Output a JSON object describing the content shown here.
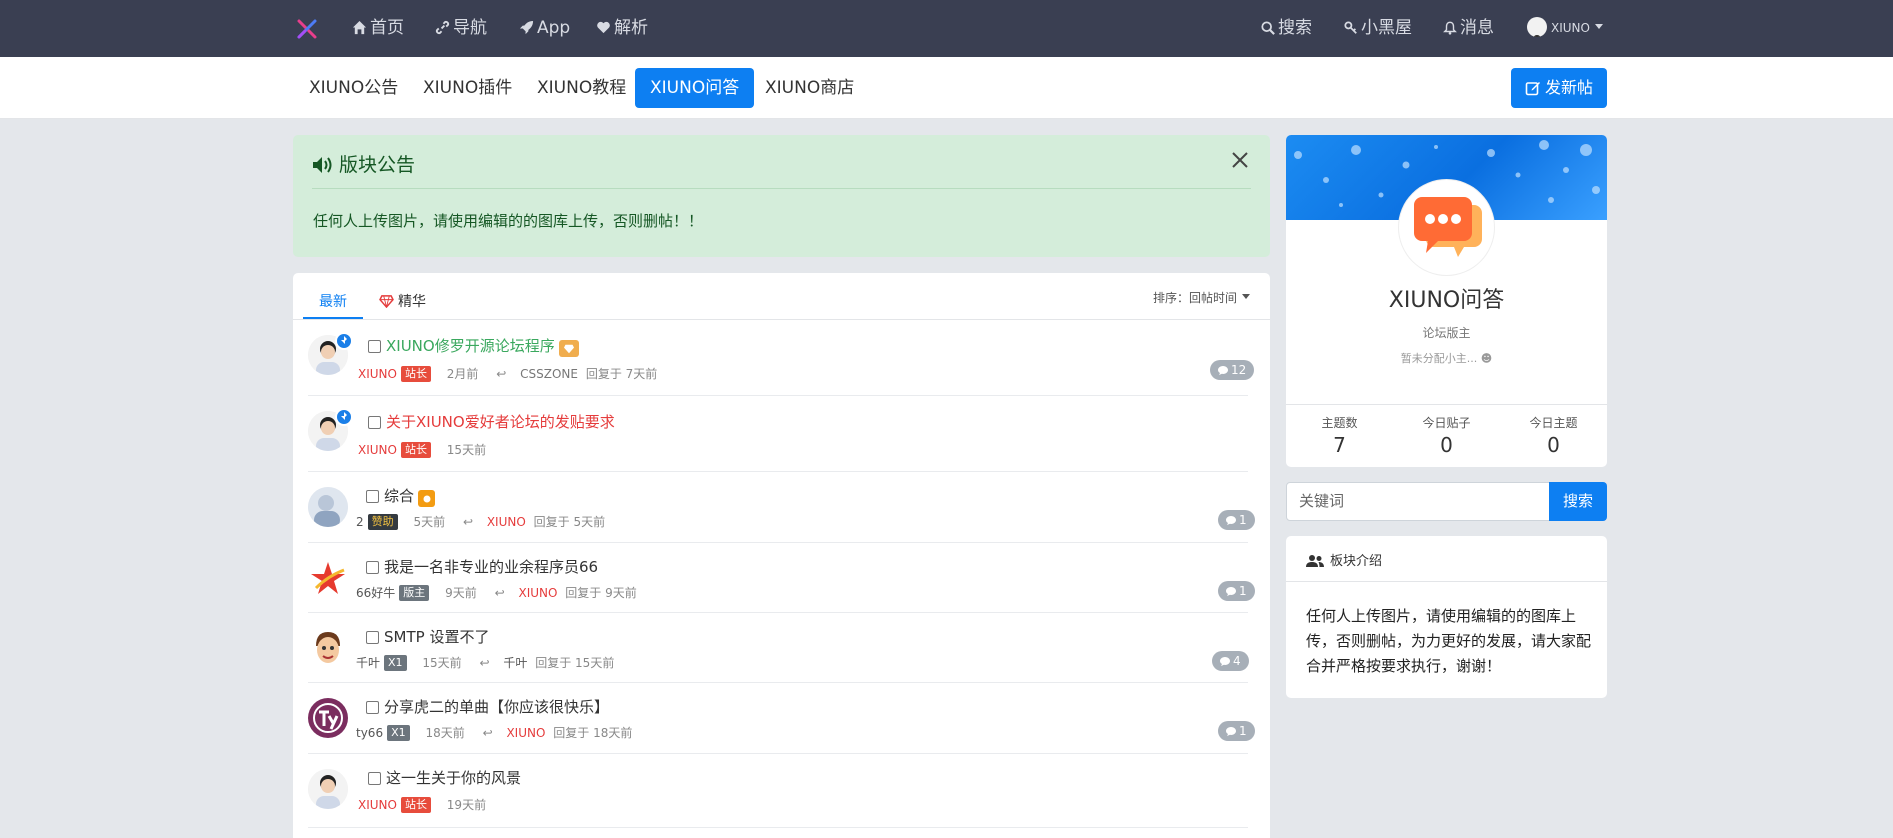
{
  "topnav": {
    "items": [
      {
        "icon": "home-icon",
        "label": "首页"
      },
      {
        "icon": "link-icon",
        "label": "导航"
      },
      {
        "icon": "rocket-icon",
        "label": "App"
      },
      {
        "icon": "heart-icon",
        "label": "解析"
      }
    ],
    "right": [
      {
        "icon": "search-icon",
        "label": "搜索"
      },
      {
        "icon": "key-icon",
        "label": "小黑屋"
      },
      {
        "icon": "bell-icon",
        "label": "消息"
      }
    ],
    "user": "XIUNO"
  },
  "subnav": {
    "tabs": [
      "XIUNO公告",
      "XIUNO插件",
      "XIUNO教程",
      "XIUNO问答",
      "XIUNO商店"
    ],
    "active": "XIUNO问答",
    "new_post": "发新帖"
  },
  "notice": {
    "title": "版块公告",
    "body": "任何人上传图片，请使用编辑的的图库上传，否则删帖！！"
  },
  "thread_tabs": {
    "latest": "最新",
    "featured": "精华",
    "sort_label": "排序：",
    "sort_value": "回帖时间"
  },
  "threads": [
    {
      "title": "XIUNO修罗开源论坛程序",
      "author": "XIUNO",
      "badge": "站长",
      "time": "2月前",
      "last_replier": "CSSZONE",
      "last_time": "回复于 7天前",
      "replies": "12"
    },
    {
      "title": "关于XIUNO爱好者论坛的发贴要求",
      "author": "XIUNO",
      "badge": "站长",
      "time": "15天前"
    },
    {
      "title": "综合",
      "author": "2",
      "badge": "赞助",
      "time": "5天前",
      "last_replier": "XIUNO",
      "last_time": "回复于 5天前",
      "replies": "1"
    },
    {
      "title": "我是一名非专业的业余程序员66",
      "author": "66好牛",
      "badge": "版主",
      "time": "9天前",
      "last_replier": "XIUNO",
      "last_time": "回复于 9天前",
      "replies": "1"
    },
    {
      "title": "SMTP 设置不了",
      "author": "千叶",
      "badge": "X1",
      "time": "15天前",
      "last_replier": "千叶",
      "last_time": "回复于 15天前",
      "replies": "4"
    },
    {
      "title": "分享虎二的单曲【你应该很快乐】",
      "author": "ty66",
      "badge": "X1",
      "time": "18天前",
      "last_replier": "XIUNO",
      "last_time": "回复于 18天前",
      "replies": "1"
    },
    {
      "title": "这一生关于你的风景",
      "author": "XIUNO",
      "badge": "站长",
      "time": "19天前"
    }
  ],
  "profile": {
    "name": "XIUNO问答",
    "role": "论坛版主",
    "moderators": "暂未分配小主...",
    "stats": [
      {
        "label": "主题数",
        "value": "7"
      },
      {
        "label": "今日贴子",
        "value": "0"
      },
      {
        "label": "今日主题",
        "value": "0"
      }
    ]
  },
  "search": {
    "placeholder": "关键词",
    "button": "搜索"
  },
  "intro": {
    "title": "板块介绍",
    "text": "任何人上传图片，请使用编辑的的图库上传，否则删帖，为力更好的发展，请大家配合并严格按要求执行，谢谢！"
  },
  "colors": {
    "topbar": "#3a3f52",
    "accent": "#0d7ff2",
    "notice_bg": "#d4edda",
    "admin_red": "#e53c3c"
  }
}
